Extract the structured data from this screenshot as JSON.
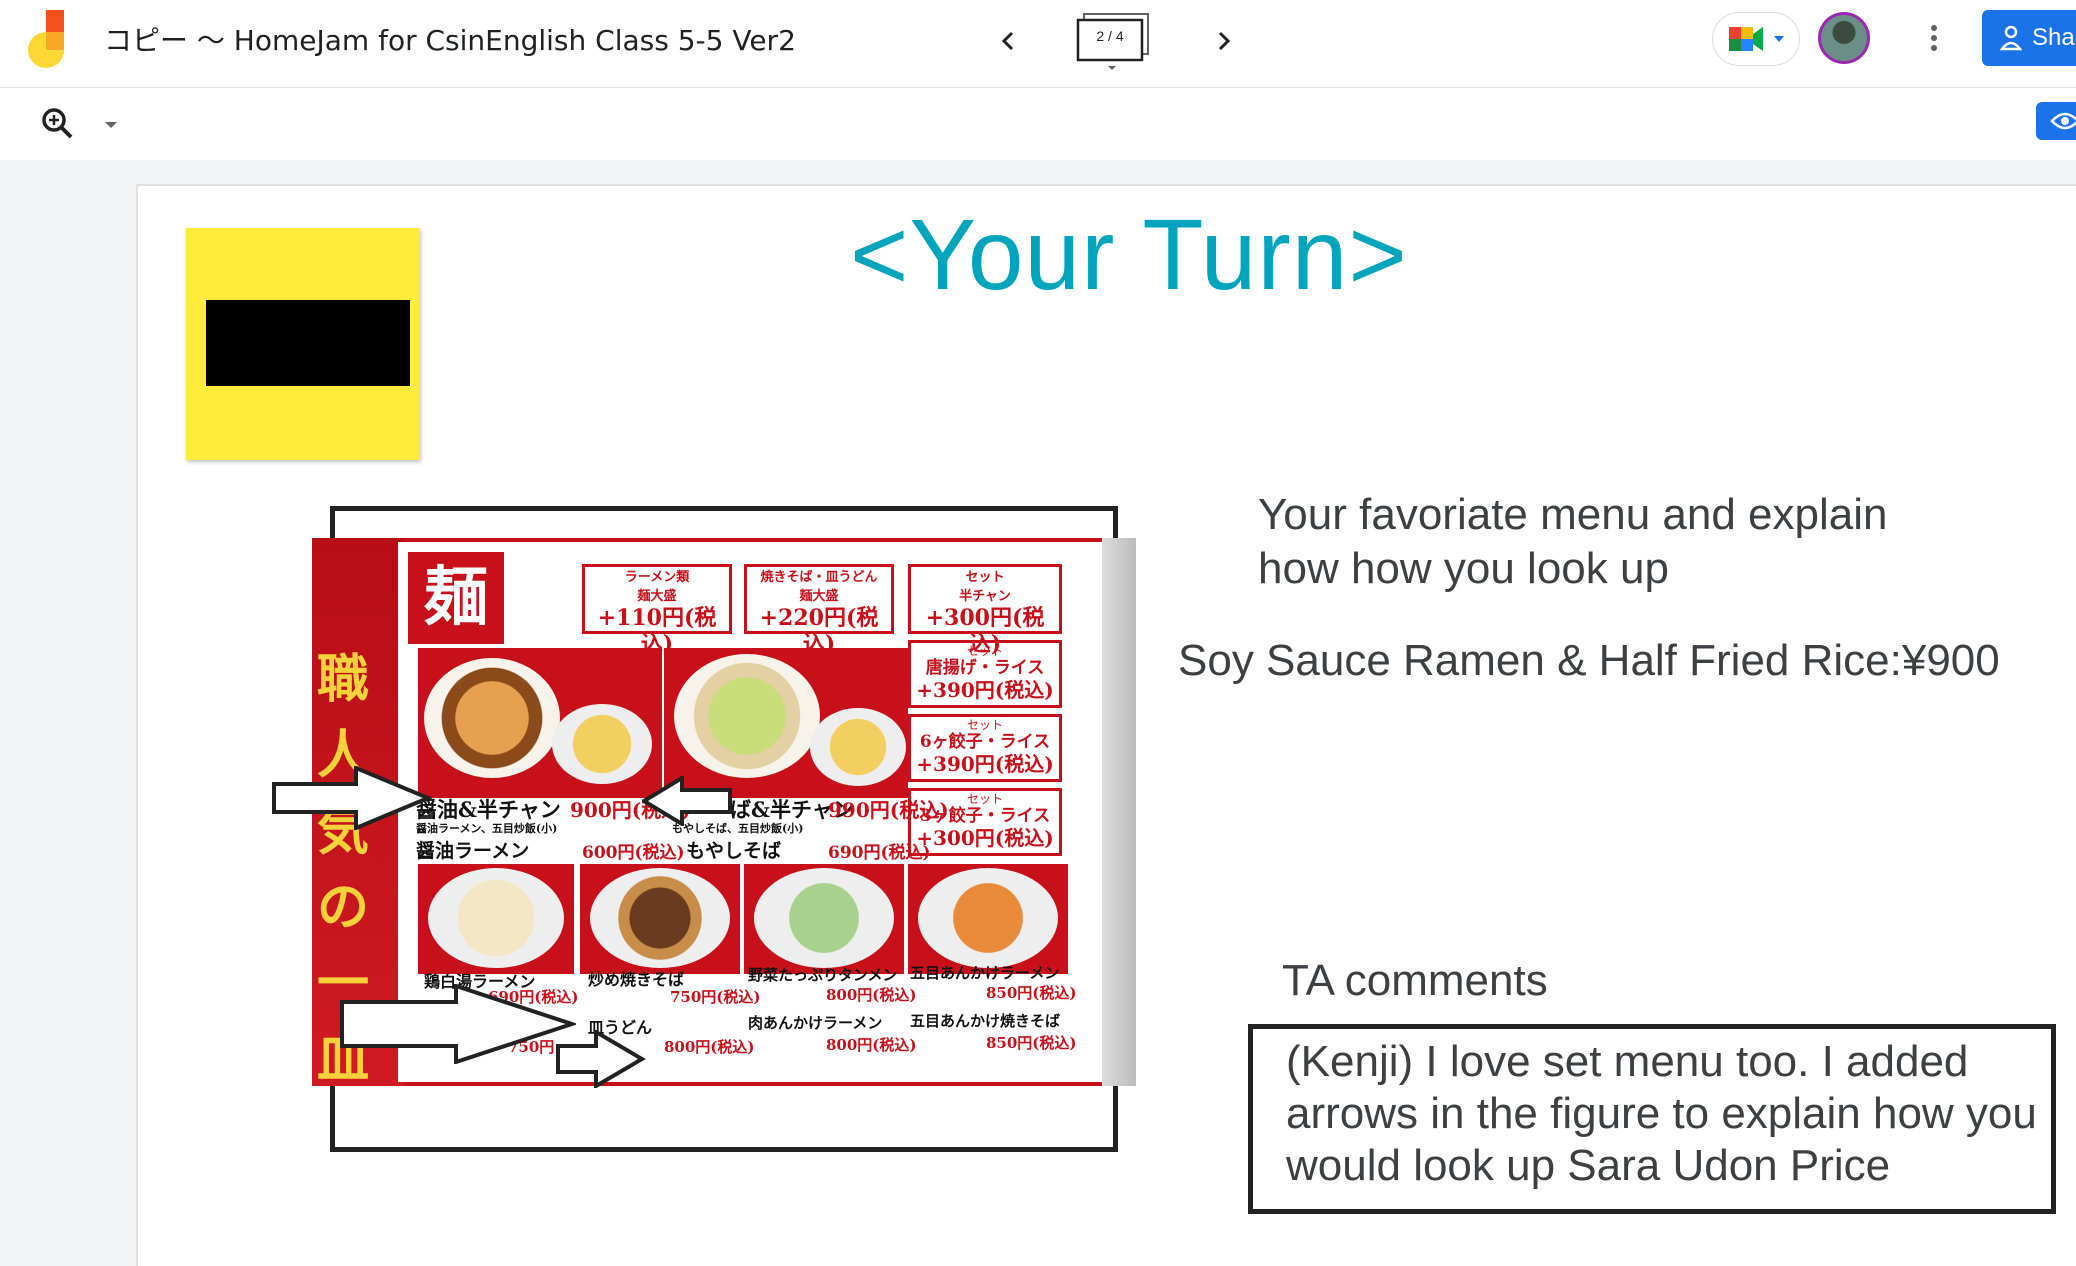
{
  "app": {
    "title": "コピー 〜 HomeJam for CsinEnglish Class 5-5 Ver2",
    "logo_icon": "jamboard-logo-icon",
    "frame_counter": "2 / 4",
    "share_label": "Sha",
    "brand_color": "#1a73e8",
    "icons": [
      "chevron-left-icon",
      "chevron-right-icon",
      "google-meet-icon",
      "more-vert-icon",
      "zoom-in-icon",
      "eye-icon",
      "person-add-icon"
    ]
  },
  "slide": {
    "title": "<Your Turn>",
    "title_color": "#00a5bd",
    "sticky_note_color": "#ffeb3b",
    "prompt_line1": "Your favoriate menu and explain",
    "prompt_line2": "how how you look up",
    "answer": "Soy Sauce Ramen & Half Fried Rice:¥900",
    "ta_label": "TA comments",
    "ta_comment": "(Kenji) I love set menu too. I added arrows in the figure to explain how you would look up Sara Udon Price"
  },
  "menu_photo": {
    "main_kanji": "麺",
    "side_strip": "職人気の一皿",
    "top_boxes": [
      {
        "small": "ラーメン類",
        "mid": "麺大盛",
        "price": "+110円(税込)"
      },
      {
        "small": "焼きそば・皿うどん",
        "mid": "麺大盛",
        "price": "+220円(税込)"
      },
      {
        "small": "セット",
        "mid": "半チャン",
        "price": "+300円(税込)"
      }
    ],
    "set_boxes": [
      {
        "small": "セット",
        "mid": "唐揚げ・ライス",
        "price": "+390円(税込)"
      },
      {
        "small": "セット",
        "mid": "6ヶ餃子・ライス",
        "price": "+390円(税込)"
      },
      {
        "small": "セット",
        "mid": "3ヶ餃子・ライス",
        "price": "+300円(税込)"
      }
    ],
    "row1": [
      {
        "name": "醤油&半チャン",
        "price": "900円(税込)"
      },
      {
        "name": "ば&半チャン",
        "price": "990円(税込)"
      }
    ],
    "row1_sub": [
      {
        "name": "醤油ラーメン、五目炒飯(小)"
      },
      {
        "name": "もやしそば、五目炒飯(小)"
      }
    ],
    "row2": [
      {
        "name": "醤油ラーメン",
        "price": "600円(税込)"
      },
      {
        "name": "もやしそば",
        "price": "690円(税込)"
      }
    ],
    "row3": [
      {
        "name": "鶏白湯ラーメン",
        "price": "690円(税込)"
      },
      {
        "name": "炒め焼きそば",
        "price": "750円(税込)"
      },
      {
        "name": "野菜たっぷりタンメン",
        "price": "800円(税込)"
      },
      {
        "name": "五目あんかけラーメン",
        "price": "850円(税込)"
      }
    ],
    "row4": [
      {
        "name": "",
        "price": "750円"
      },
      {
        "name": "皿うどん",
        "price": "800円(税込)"
      },
      {
        "name": "肉あんかけラーメン",
        "price": "800円(税込)"
      },
      {
        "name": "五目あんかけ焼きそば",
        "price": "850円(税込)"
      }
    ]
  }
}
